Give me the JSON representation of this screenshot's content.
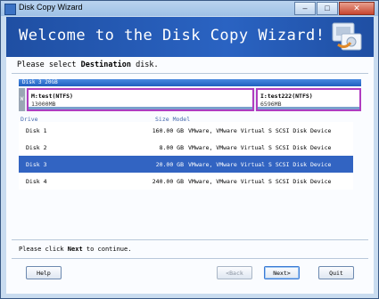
{
  "window": {
    "title": "Disk Copy Wizard",
    "controls": [
      "–",
      "□",
      "✕"
    ]
  },
  "banner": {
    "heading": "Welcome to the Disk Copy Wizard!"
  },
  "instruction": {
    "prefix": "Please select ",
    "emph": "Destination",
    "suffix": " disk."
  },
  "disk_map": {
    "label": "Disk 3   20GB",
    "head": "W",
    "partitions": [
      {
        "name": "M:test(NTFS)",
        "size": "13000MB"
      },
      {
        "name": "I:test222(NTFS)",
        "size": "6596MB"
      }
    ]
  },
  "table": {
    "headers": {
      "drive": "Drive",
      "size_model": "Size Model"
    },
    "rows": [
      {
        "drive": "Disk 1",
        "size": "160.00 GB",
        "model": "VMware,  VMware Virtual S SCSI Disk Device",
        "selected": false
      },
      {
        "drive": "Disk 2",
        "size": "8.00 GB",
        "model": "VMware,  VMware Virtual S SCSI Disk Device",
        "selected": false
      },
      {
        "drive": "Disk 3",
        "size": "20.00 GB",
        "model": "VMware,  VMware Virtual S SCSI Disk Device",
        "selected": true
      },
      {
        "drive": "Disk 4",
        "size": "240.00 GB",
        "model": "VMware,  VMware Virtual S SCSI Disk Device",
        "selected": false
      }
    ]
  },
  "footer": {
    "prefix": "Please click ",
    "emph": "Next",
    "suffix": " to continue."
  },
  "buttons": {
    "help": "Help",
    "back": "<Back",
    "next": "Next>",
    "quit": "Quit"
  },
  "colors": {
    "banner": "#1f4fa3",
    "selection": "#3264c2",
    "partition_border": "#b03cc0"
  }
}
